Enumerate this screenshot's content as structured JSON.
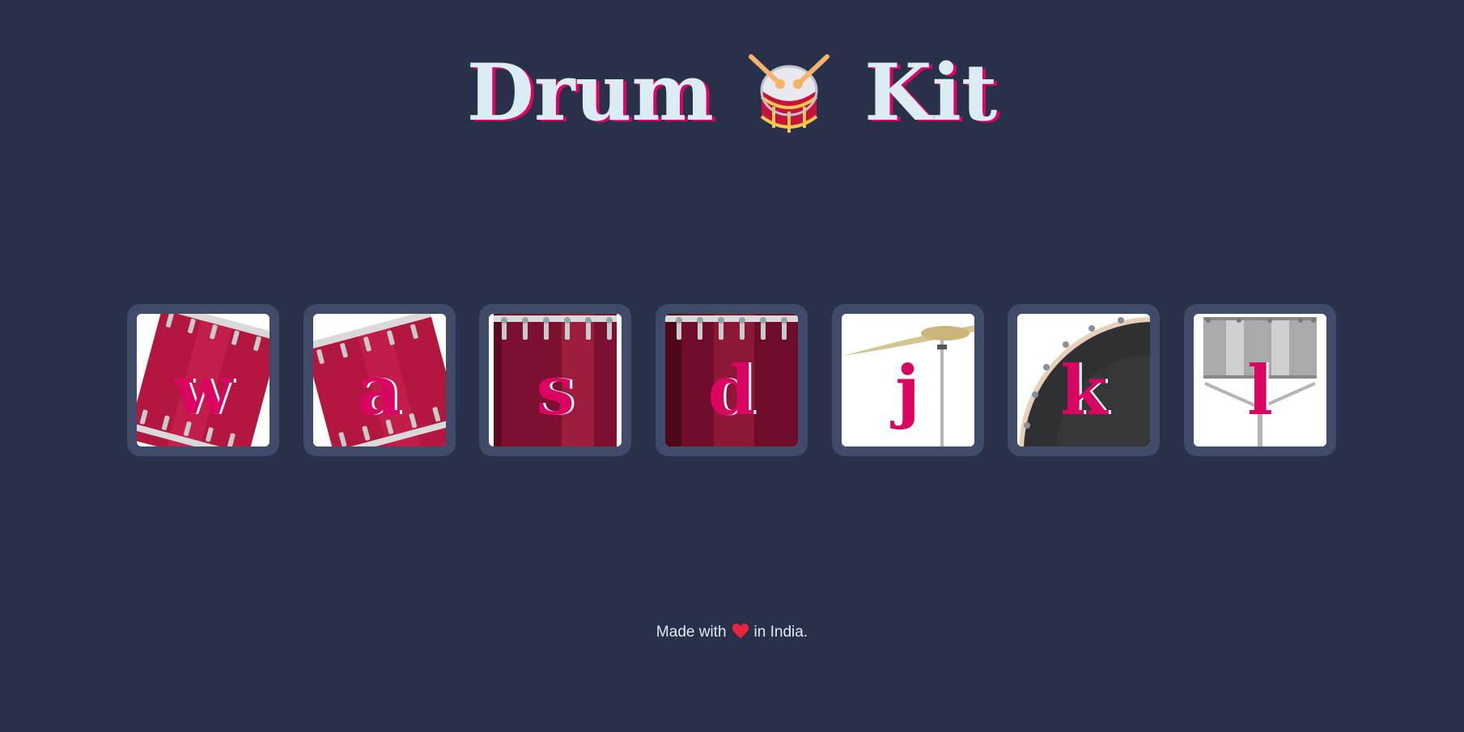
{
  "title": {
    "before": "Drum",
    "emoji_icon": "drum-with-sticks-icon",
    "after": "Kit"
  },
  "drums": [
    {
      "key": "w",
      "icon": "tom-drum-icon"
    },
    {
      "key": "a",
      "icon": "tom-drum-icon"
    },
    {
      "key": "s",
      "icon": "snare-drum-icon"
    },
    {
      "key": "d",
      "icon": "snare-drum-icon"
    },
    {
      "key": "j",
      "icon": "crash-cymbal-icon"
    },
    {
      "key": "k",
      "icon": "kick-drum-icon"
    },
    {
      "key": "l",
      "icon": "hi-hat-stand-icon"
    }
  ],
  "footer": {
    "before": "Made with",
    "heart_icon": "heart-icon",
    "after": "in India."
  },
  "colors": {
    "background": "#283149",
    "tile": "#404b69",
    "accent": "#da0463",
    "text": "#dbedf3"
  }
}
